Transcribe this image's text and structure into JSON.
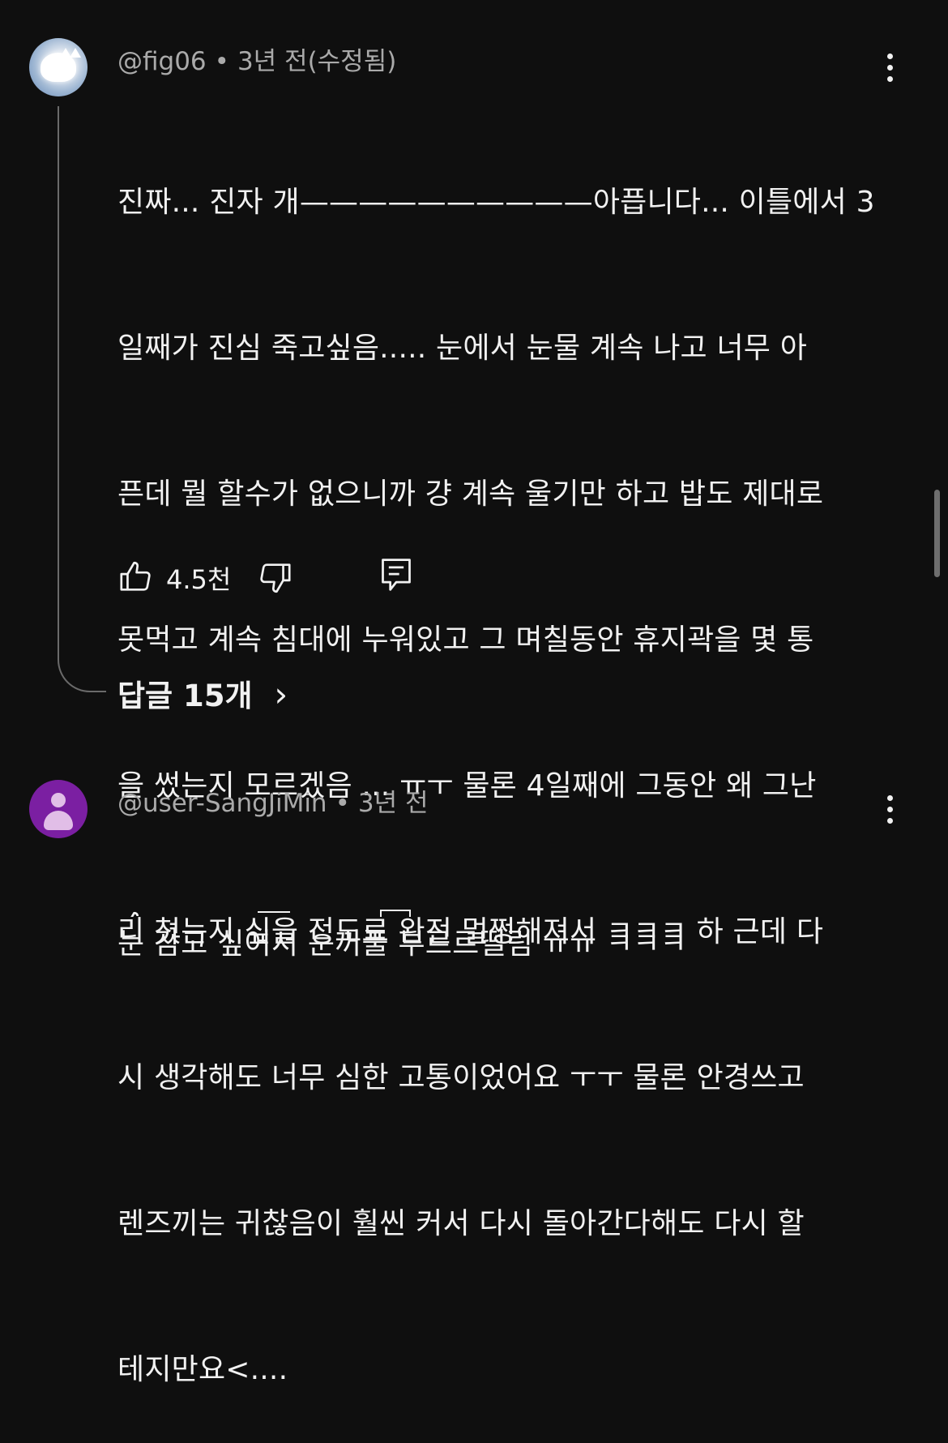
{
  "comments": [
    {
      "handle": "@fig06",
      "meta_sep": "•",
      "time": "3년 전(수정됨)",
      "text_lines": [
        "진짜... 진자 개——————————아픕니다... 이틀에서 3",
        "일째가 진심 죽고싶음..... 눈에서 눈물 계속 나고 너무 아",
        "픈데 뭘 할수가 없으니까 걍 계속 울기만 하고 밥도 제대로",
        "못먹고 계속 침대에 누워있고 그 며칠동안 휴지곽을 몇 통",
        "을 썼는지 모르겠음 ... ㅠㅜ 물론 4일째에 그동안 왜 그난",
        "리 쳤는지 싶을 정도로 완전 멀쩡해져서 ㅋㅋㅋ 하 근데 다",
        "시 생각해도 너무 심한 고통이었어요 ㅜㅜ 물론 안경쓰고",
        "렌즈끼는 귀찮음이 훨씬 커서 다시 돌아간다해도 다시 할",
        "테지만요<...."
      ],
      "like_count": "4.5천",
      "replies_label": "답글 15개",
      "replies_chevron": "›"
    },
    {
      "handle": "@user-SangJiMin",
      "meta_sep": "•",
      "time": "3년 전",
      "text_lines": [
        "눈 감고 싶어서 눈꺼풀 부르르떨림 ㅠㅠ ㅋㅋㅋ"
      ]
    }
  ],
  "icons": {
    "more": "more-vert-icon",
    "like": "thumb-up-icon",
    "dislike": "thumb-down-icon",
    "reply": "comment-icon",
    "avatar_default": "person-icon"
  },
  "colors": {
    "background": "#0f0f0f",
    "text": "#f1f1f1",
    "meta": "#aaaaaa",
    "thread_line": "#6a6a6a",
    "avatar_default_bg": "#7b1fa2"
  }
}
